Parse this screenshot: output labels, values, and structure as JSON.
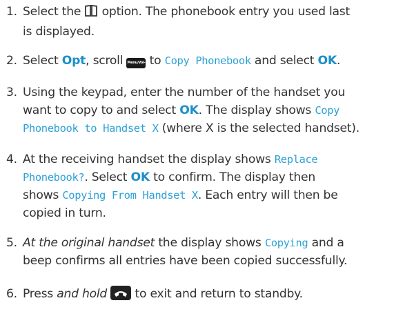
{
  "steps": [
    {
      "n": "1.",
      "a": "Select the",
      "icon": "phonebook-icon",
      "b": "option. The phonebook entry you used last",
      "c": "is displayed."
    },
    {
      "n": "2.",
      "a": "Select",
      "opt": "Opt",
      "b": ", scroll",
      "navkey_label": "Menu/Vol-",
      "c": "to",
      "lcd": "Copy Phonebook",
      "d": "and select",
      "ok": "OK",
      "e": "."
    },
    {
      "n": "3.",
      "a": "Using the keypad, enter the number of the handset you",
      "b": "want to copy to and select",
      "ok": "OK",
      "c": ". The display shows",
      "lcd1": "Copy",
      "lcd2": "Phonebook to Handset X",
      "d": "(where X is the selected handset)."
    },
    {
      "n": "4.",
      "a": "At the receiving handset the display shows",
      "lcd1": "Replace",
      "lcd2": "Phonebook?",
      "b": ". Select",
      "ok": "OK",
      "c": "to confirm. The display then",
      "d": "shows",
      "lcd3": "Copying From Handset X",
      "e": ". Each entry will then be",
      "f": "copied in turn."
    },
    {
      "n": "5.",
      "ital": "At the original handset",
      "a": "the display shows",
      "lcd": "Copying",
      "b": "and a",
      "c": "beep confirms all entries have been copied successfully."
    },
    {
      "n": "6.",
      "a": "Press",
      "ital": "and hold",
      "icon": "end-call-icon",
      "b": "to exit and return to standby."
    }
  ],
  "colors": {
    "keyword": "#1b8fc9",
    "display_text": "#2ca0d6",
    "body_text": "#333333"
  }
}
